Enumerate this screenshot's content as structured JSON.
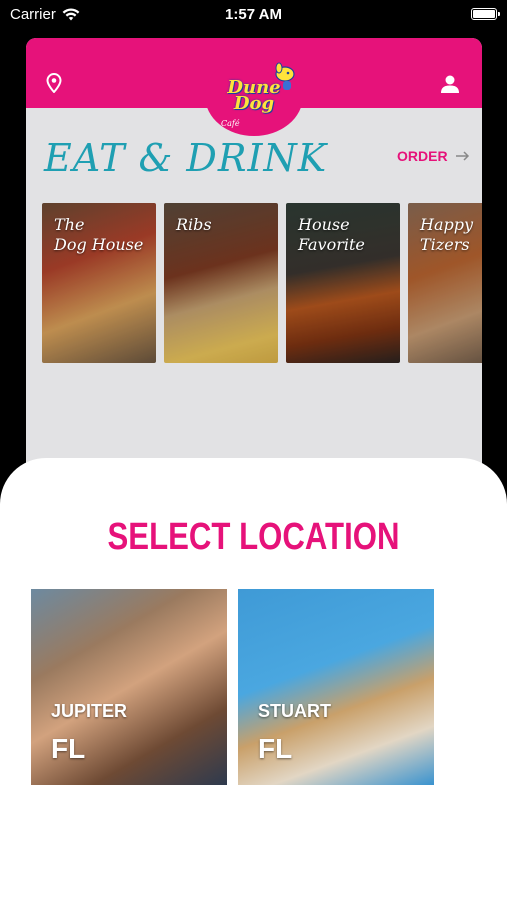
{
  "status_bar": {
    "carrier": "Carrier",
    "time": "1:57 AM"
  },
  "header": {
    "logo_text": "Dune\nDog",
    "logo_cafe": "Café",
    "brand_color": "#e6127a",
    "icons": {
      "left": "location-pin-icon",
      "right": "user-icon"
    }
  },
  "eat_drink": {
    "title": "EAT & DRINK",
    "title_color": "#1f9fb2",
    "order_label": "ORDER",
    "categories": [
      {
        "label": "The\nDog House"
      },
      {
        "label": "Ribs"
      },
      {
        "label": "House\nFavorite"
      },
      {
        "label": "Happy\nTizers"
      }
    ]
  },
  "select_location": {
    "title": "SELECT LOCATION",
    "locations": [
      {
        "city": "JUPITER",
        "state": "FL"
      },
      {
        "city": "STUART",
        "state": "FL"
      }
    ]
  }
}
